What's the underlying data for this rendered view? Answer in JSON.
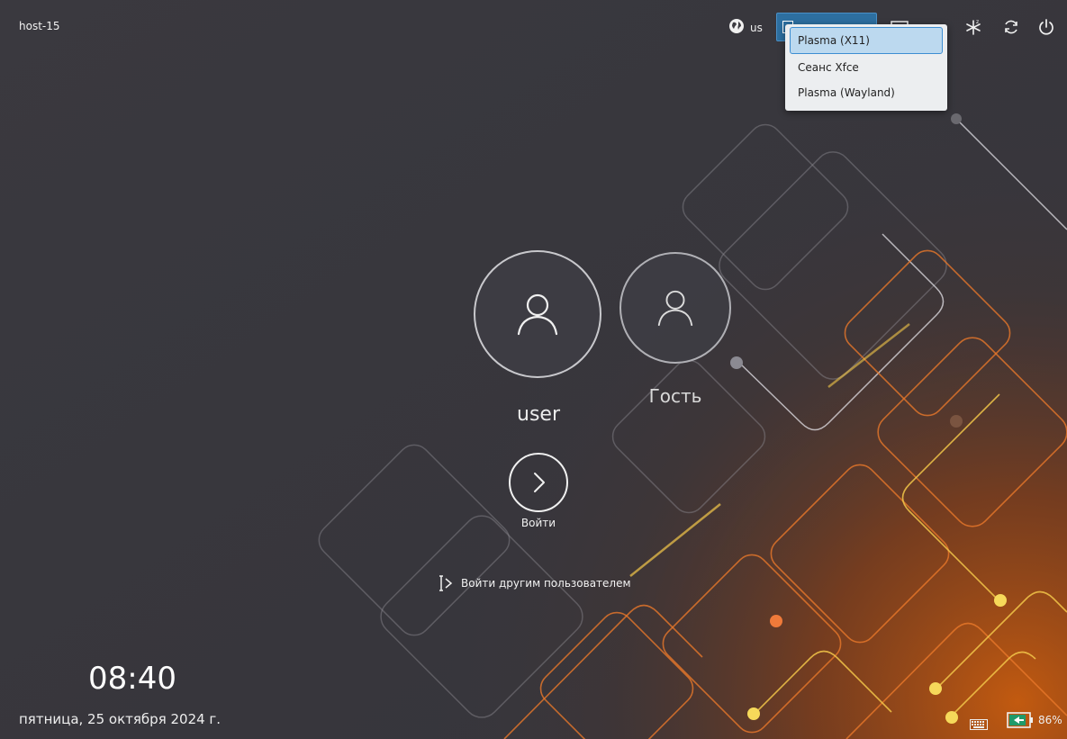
{
  "hostname": "host-15",
  "keyboard_layout": {
    "label": "us",
    "icon": "globe-icon"
  },
  "session_menu": {
    "items": [
      "Plasma (X11)",
      "Сеанс Xfce",
      "Plasma (Wayland)"
    ],
    "selected": "Plasma (X11)"
  },
  "top_icons": [
    "virtual-keyboard-icon",
    "snowflake-icon",
    "restart-icon",
    "power-icon"
  ],
  "users": [
    {
      "name": "user",
      "icon": "user-avatar-icon"
    },
    {
      "name": "Гость",
      "icon": "user-avatar-icon"
    }
  ],
  "login": {
    "label": "Войти",
    "icon": "arrow-right-icon"
  },
  "other_user": {
    "label": "Войти другим пользователем",
    "icon": "other-user-icon"
  },
  "clock": {
    "time": "08:40",
    "date": "пятница, 25 октября 2024 г."
  },
  "tray": {
    "battery_percent": "86%",
    "battery_level": 0.86
  },
  "colors": {
    "background": "#3b3a40",
    "accent": "#2d6fa0",
    "menu_selected": "#bcd9ef",
    "glow_orange": "#f07a1a",
    "glow_yellow": "#f5d84a"
  }
}
